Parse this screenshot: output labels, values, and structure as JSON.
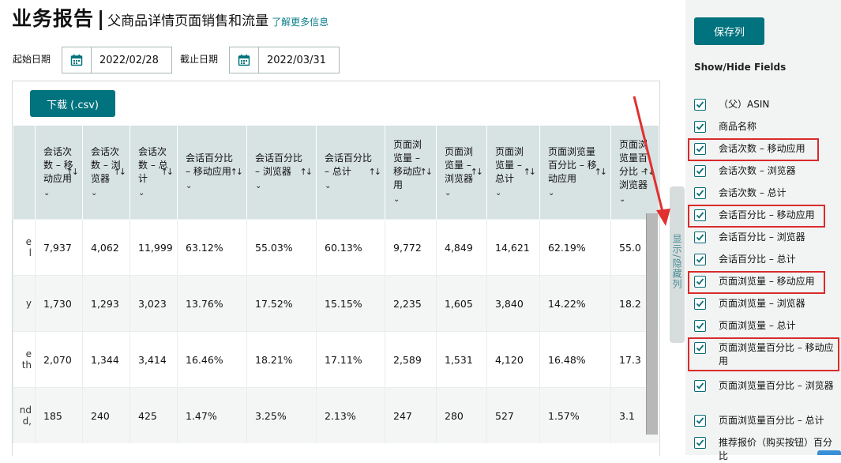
{
  "header": {
    "title": "业务报告",
    "separator": "|",
    "subtitle": "父商品详情页面销售和流量",
    "learn_more": "了解更多信息"
  },
  "dates": {
    "start_label": "起始日期",
    "start_value": "2022/02/28",
    "end_label": "截止日期",
    "end_value": "2022/03/31"
  },
  "toolbar": {
    "download_label": "下载 (.csv)"
  },
  "table": {
    "columns": [
      "会话次数 – 移动应用",
      "会话次数 – 浏览器",
      "会话次数 – 总计",
      "会话百分比 – 移动应用",
      "会话百分比 – 浏览器",
      "会话百分比 – 总计",
      "页面浏览量 – 移动应用",
      "页面浏览量 – 浏览器",
      "页面浏览量 – 总计",
      "页面浏览量百分比 – 移动应用",
      "页面浏览量百分比 – 浏览器"
    ],
    "rows": [
      {
        "first": "e\nl",
        "cells": [
          "7,937",
          "4,062",
          "11,999",
          "63.12%",
          "55.03%",
          "60.13%",
          "9,772",
          "4,849",
          "14,621",
          "62.19%",
          "55.0"
        ]
      },
      {
        "first": "y",
        "cells": [
          "1,730",
          "1,293",
          "3,023",
          "13.76%",
          "17.52%",
          "15.15%",
          "2,235",
          "1,605",
          "3,840",
          "14.22%",
          "18.2"
        ]
      },
      {
        "first": "e\nth",
        "cells": [
          "2,070",
          "1,344",
          "3,414",
          "16.46%",
          "18.21%",
          "17.11%",
          "2,589",
          "1,531",
          "4,120",
          "16.48%",
          "17.3"
        ]
      },
      {
        "first": "nd\nd,",
        "cells": [
          "185",
          "240",
          "425",
          "1.47%",
          "3.25%",
          "2.13%",
          "247",
          "280",
          "527",
          "1.57%",
          "3.1"
        ]
      }
    ]
  },
  "side_toggle": "显示/隐藏列",
  "right_panel": {
    "save_label": "保存列",
    "heading": "Show/Hide Fields",
    "fields": [
      {
        "label": "（父）ASIN",
        "checked": true
      },
      {
        "label": "商品名称",
        "checked": true
      },
      {
        "label": "会话次数 – 移动应用",
        "checked": true
      },
      {
        "label": "会话次数 – 浏览器",
        "checked": true
      },
      {
        "label": "会话次数 – 总计",
        "checked": true
      },
      {
        "label": "会话百分比 – 移动应用",
        "checked": true
      },
      {
        "label": "会话百分比 – 浏览器",
        "checked": true
      },
      {
        "label": "会话百分比 – 总计",
        "checked": true
      },
      {
        "label": "页面浏览量 – 移动应用",
        "checked": true
      },
      {
        "label": "页面浏览量 – 浏览器",
        "checked": true
      },
      {
        "label": "页面浏览量 – 总计",
        "checked": true
      },
      {
        "label": "页面浏览量百分比 – 移动应用",
        "checked": true
      },
      {
        "label": "页面浏览量百分比 – 浏览器",
        "checked": true
      },
      {
        "label": "页面浏览量百分比 – 总计",
        "checked": true
      },
      {
        "label": "推荐报价（购买按钮）百分比",
        "checked": true
      }
    ]
  },
  "colors": {
    "accent": "#00737e",
    "highlight": "#d92b2b",
    "header_bg": "#d7e2e2",
    "panel_bg": "#f2f4f4"
  }
}
